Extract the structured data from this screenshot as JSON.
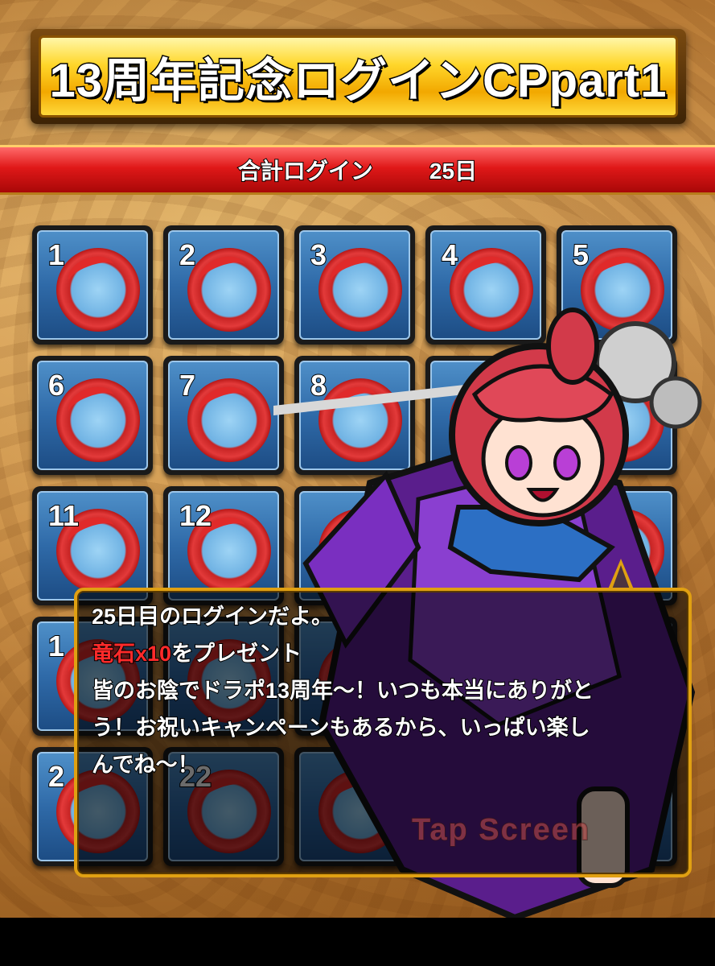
{
  "title": "13周年記念ログインCPpart1",
  "total_login": {
    "label": "合計ログイン",
    "value": "25日"
  },
  "calendar": {
    "reward_icon": "red-dragon-stone-icon",
    "days": [
      "1",
      "2",
      "3",
      "4",
      "5",
      "6",
      "7",
      "8",
      "",
      "",
      "11",
      "12",
      "",
      "",
      "",
      "1",
      "",
      "",
      "",
      "",
      "2",
      "22",
      "",
      "",
      ""
    ]
  },
  "dialog": {
    "line1": "25日目のログインだよ。",
    "reward_highlight": "竜石x10",
    "reward_suffix": "をプレゼント",
    "line3": "皆のお陰でドラポ13周年～！いつも本当にありがと",
    "line4": "う！お祝いキャンペーンもあるから、いっぱい楽し",
    "line5": "んでね～！"
  },
  "tap_hint": "Tap Screen",
  "colors": {
    "accent_gold": "#e0a012",
    "banner_red": "#e01818",
    "highlight_red": "#ff2a2a",
    "tile_blue": "#2f6aa8"
  }
}
